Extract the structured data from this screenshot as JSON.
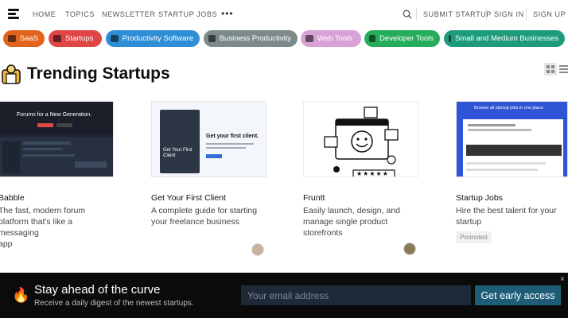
{
  "nav": {
    "links": [
      "HOME",
      "TOPICS",
      "NEWSLETTER",
      "STARTUP JOBS"
    ],
    "more": "•••",
    "right": [
      "SUBMIT STARTUP",
      "SIGN IN",
      "SIGN UP"
    ]
  },
  "categories": [
    {
      "label": "SaaS",
      "color": "#e0641c",
      "icon": "laptop-icon"
    },
    {
      "label": "Startups",
      "color": "#e04646",
      "icon": "rocket-icon"
    },
    {
      "label": "Productivity Software",
      "color": "#2f8fd6",
      "icon": "window-icon"
    },
    {
      "label": "Business Productivity",
      "color": "#7c8a8a",
      "icon": "gear-icon"
    },
    {
      "label": "Web Tools",
      "color": "#d9a2d6",
      "icon": "hammer-icon"
    },
    {
      "label": "Developer Tools",
      "color": "#25ad5a",
      "icon": "keyboard-icon"
    },
    {
      "label": "Small and Medium Businesses",
      "color": "#1e9b7a",
      "icon": "building-icon"
    }
  ],
  "section_title": "Trending Startups",
  "cards": [
    {
      "title": "Babble",
      "desc_lines": [
        "The fast, modern forum",
        "platform that's like a messaging",
        "app"
      ],
      "thumb_text": [
        "Forums for a New Generation."
      ],
      "badge": ""
    },
    {
      "title": "Get Your First Client",
      "desc_lines": [
        "A complete guide for starting",
        "your freelance business"
      ],
      "thumb_text": [
        "Get your first client.",
        "Get Your First Client"
      ],
      "badge": ""
    },
    {
      "title": "Fruntt",
      "desc_lines": [
        "Easily launch, design, and",
        "manage single product",
        "storefronts"
      ],
      "thumb_text": [
        "★★★★★"
      ],
      "badge": ""
    },
    {
      "title": "Startup Jobs",
      "desc_lines": [
        "Hire the best talent for your",
        "startup"
      ],
      "thumb_text": [
        "Browse all startup jobs in one place."
      ],
      "badge": "Promoted"
    }
  ],
  "banner": {
    "title": "Stay ahead of the curve",
    "subtitle": "Receive a daily digest of the newest startups.",
    "email_placeholder": "Your email address",
    "cta": "Get early access",
    "close": "×"
  }
}
